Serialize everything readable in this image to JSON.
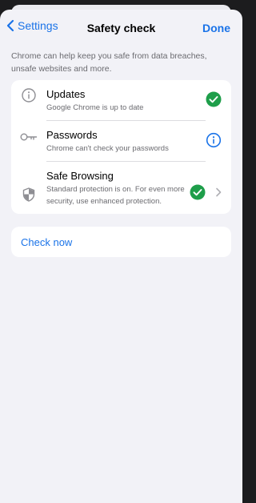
{
  "nav": {
    "back_label": "Settings",
    "title": "Safety check",
    "done_label": "Done"
  },
  "intro": "Chrome can help keep you safe from data breaches, unsafe websites and more.",
  "items": [
    {
      "title": "Updates",
      "subtitle": "Google Chrome is up to date",
      "status": "ok"
    },
    {
      "title": "Passwords",
      "subtitle": "Chrome can't check your passwords",
      "status": "info"
    },
    {
      "title": "Safe Browsing",
      "subtitle": "Standard protection is on. For even more security, use enhanced protection.",
      "status": "ok"
    }
  ],
  "check_now_label": "Check now",
  "colors": {
    "accent": "#1a73e8",
    "success": "#1e9e4a"
  }
}
